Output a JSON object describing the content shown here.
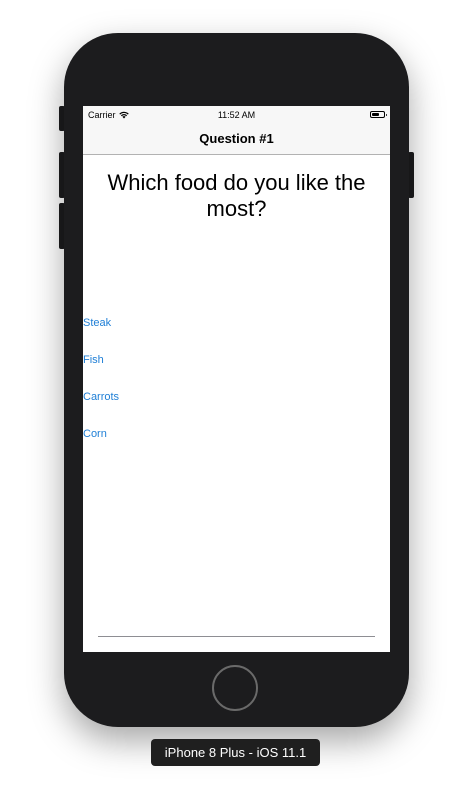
{
  "status_bar": {
    "carrier": "Carrier",
    "time": "11:52 AM",
    "wifi_icon": "wifi-icon",
    "battery_icon": "battery-icon"
  },
  "nav": {
    "title": "Question #1"
  },
  "question": {
    "text": "Which food do you like the most?"
  },
  "answers": [
    {
      "label": "Steak"
    },
    {
      "label": "Fish"
    },
    {
      "label": "Carrots"
    },
    {
      "label": "Corn"
    }
  ],
  "device": {
    "label": "iPhone 8 Plus - iOS 11.1",
    "home_button_icon": "home-button-icon"
  },
  "colors": {
    "link": "#1f7fd6",
    "bezel": "#1c1c1e",
    "bar_background": "#f7f7f7"
  }
}
